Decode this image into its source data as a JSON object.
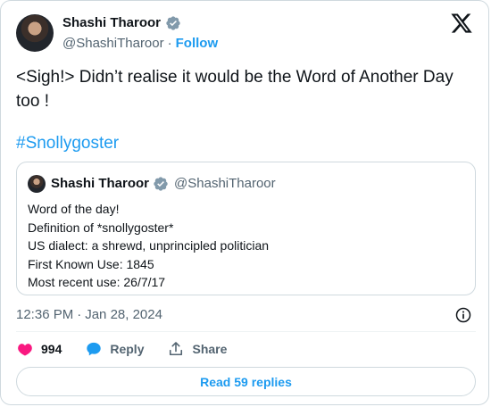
{
  "author": {
    "name": "Shashi Tharoor",
    "handle": "@ShashiTharoor",
    "separator": "·",
    "follow_label": "Follow"
  },
  "tweet": {
    "text": "<Sigh!> Didn’t realise it would be the Word of Another Day too !",
    "hashtag": "#Snollygoster"
  },
  "quoted": {
    "name": "Shashi Tharoor",
    "handle": "@ShashiTharoor",
    "lines": [
      "Word of the day!",
      "Definition of *snollygoster*",
      "US dialect: a shrewd, unprincipled politician",
      "First Known Use: 1845",
      "Most recent use: 26/7/17"
    ]
  },
  "meta": {
    "time": "12:36 PM",
    "separator": "·",
    "date": "Jan 28, 2024"
  },
  "actions": {
    "like_count": "994",
    "reply_label": "Reply",
    "share_label": "Share"
  },
  "read_replies_label": "Read 59 replies",
  "colors": {
    "accent": "#1d9bf0",
    "like": "#f91880",
    "text": "#0f1419",
    "muted": "#536471",
    "border": "#cfd9de"
  },
  "icons": [
    "verified-badge-icon",
    "x-logo-icon",
    "info-icon",
    "heart-icon",
    "reply-bubble-icon",
    "share-icon"
  ]
}
